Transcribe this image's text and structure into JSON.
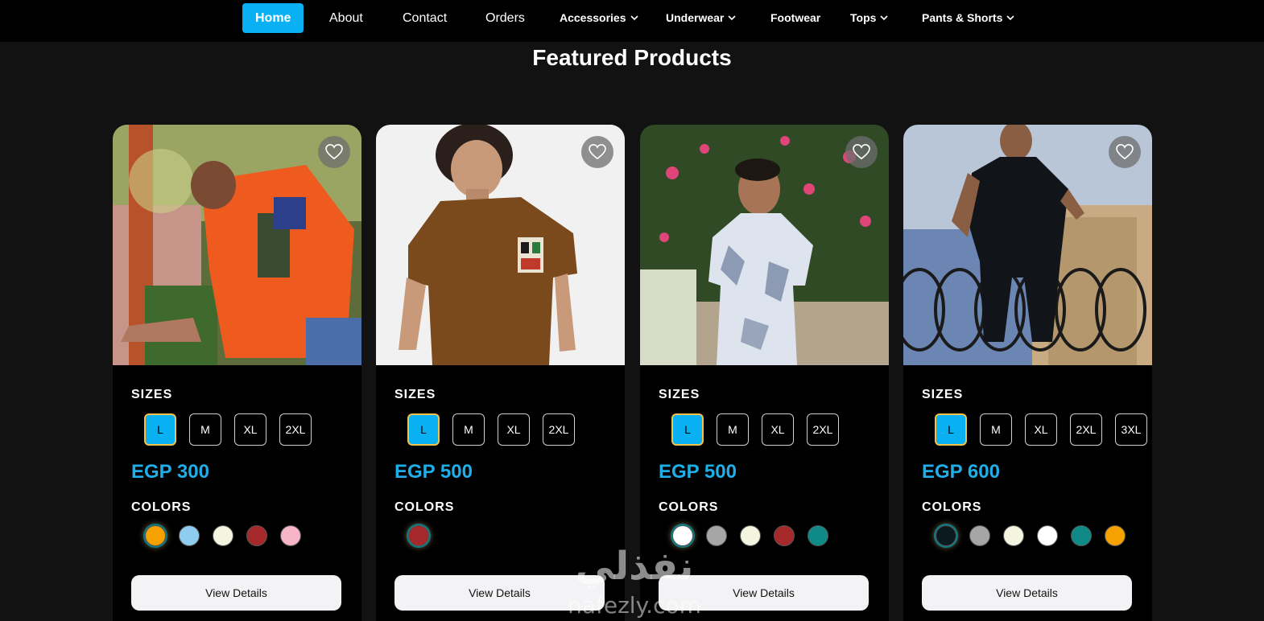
{
  "nav": {
    "items": [
      {
        "label": "Home",
        "active": true,
        "dropdown": false
      },
      {
        "label": "About",
        "active": false,
        "dropdown": false
      },
      {
        "label": "Contact",
        "active": false,
        "dropdown": false
      },
      {
        "label": "Orders",
        "active": false,
        "dropdown": false
      },
      {
        "label": "Accessories",
        "active": false,
        "dropdown": true
      },
      {
        "label": "Underwear",
        "active": false,
        "dropdown": true
      },
      {
        "label": "Footwear",
        "active": false,
        "dropdown": false
      },
      {
        "label": "Tops",
        "active": false,
        "dropdown": true
      },
      {
        "label": "Pants & Shorts",
        "active": false,
        "dropdown": true
      }
    ],
    "accent_color": "#0ab1f2"
  },
  "page_title": "Featured Products",
  "products": [
    {
      "sizes_label": "SIZES",
      "sizes": [
        "L",
        "M",
        "XL",
        "2XL"
      ],
      "selected_size": "L",
      "price": "EGP 300",
      "colors_label": "COLORS",
      "colors": [
        "#f5a100",
        "#8ecdf0",
        "#f4f5e1",
        "#a5292b",
        "#f7b6c8"
      ],
      "selected_color": 0,
      "button_label": "View Details",
      "image_icon": "orange-tshirt-photo"
    },
    {
      "sizes_label": "SIZES",
      "sizes": [
        "L",
        "M",
        "XL",
        "2XL"
      ],
      "selected_size": "L",
      "price": "EGP 500",
      "colors_label": "COLORS",
      "colors": [
        "#a5292b"
      ],
      "selected_color": 0,
      "button_label": "View Details",
      "image_icon": "brown-tshirt-photo"
    },
    {
      "sizes_label": "SIZES",
      "sizes": [
        "L",
        "M",
        "XL",
        "2XL"
      ],
      "selected_size": "L",
      "price": "EGP 500",
      "colors_label": "COLORS",
      "colors": [
        "#ffffff",
        "#a6a6a6",
        "#f4f5e1",
        "#a5292b",
        "#0f8a86"
      ],
      "selected_color": 0,
      "button_label": "View Details",
      "image_icon": "floral-shirt-photo"
    },
    {
      "sizes_label": "SIZES",
      "sizes": [
        "L",
        "M",
        "XL",
        "2XL",
        "3XL"
      ],
      "selected_size": "L",
      "price": "EGP 600",
      "colors_label": "COLORS",
      "colors": [
        "#0a1a1e",
        "#a6a6a6",
        "#f4f5e1",
        "#ffffff",
        "#0f8a86",
        "#f5a100"
      ],
      "selected_color": 0,
      "button_label": "View Details",
      "image_icon": "black-shirt-photo"
    }
  ],
  "watermark": {
    "text_ar": "نفذلي",
    "text_en": "nafezly.com"
  }
}
